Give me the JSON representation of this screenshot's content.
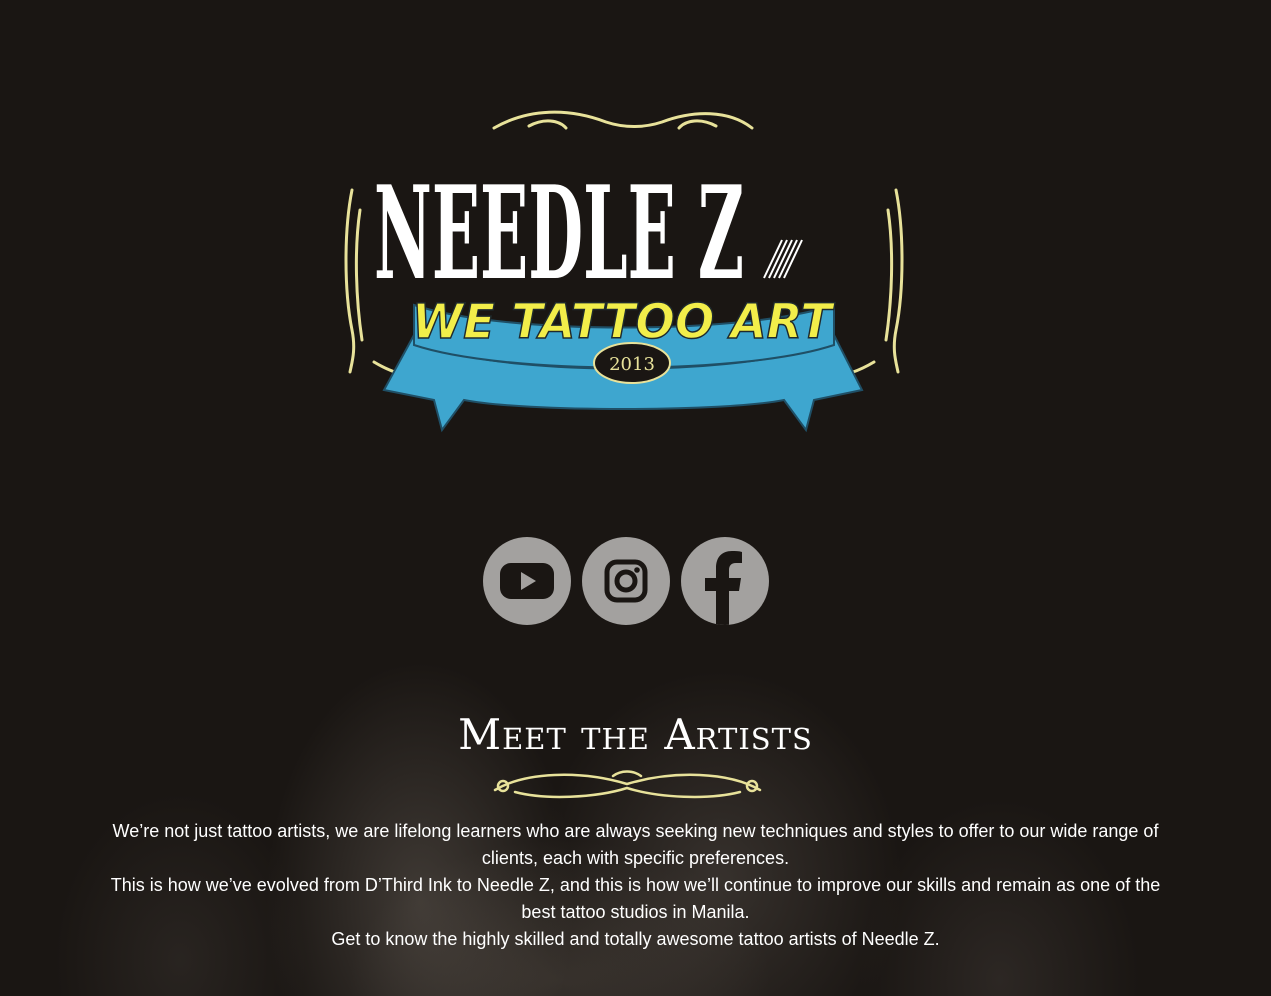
{
  "logo": {
    "brand": "NEEDLE Z",
    "tagline": "WE TATTOO ART",
    "year": "2013"
  },
  "social": [
    {
      "icon": "youtube-icon",
      "label": "YouTube"
    },
    {
      "icon": "instagram-icon",
      "label": "Instagram"
    },
    {
      "icon": "facebook-icon",
      "label": "Facebook"
    }
  ],
  "artists": {
    "title": "Meet the Artists",
    "paragraphs": [
      "We’re not just tattoo artists, we are lifelong learners who are always seeking new techniques and styles to offer to our wide range of clients, each with specific preferences.",
      "This is how we’ve evolved from D’Third Ink to Needle Z, and this is how we’ll continue to improve our skills and remain as one of the best tattoo studios in Manila.",
      "Get to know the highly skilled and totally awesome tattoo artists of Needle Z."
    ]
  },
  "colors": {
    "background": "#1a1613",
    "accent_gold": "#e8e29a",
    "ribbon_blue": "#3ea6cf",
    "tagline_yellow": "#f2ee4a",
    "social_grey": "#a3a19f"
  }
}
